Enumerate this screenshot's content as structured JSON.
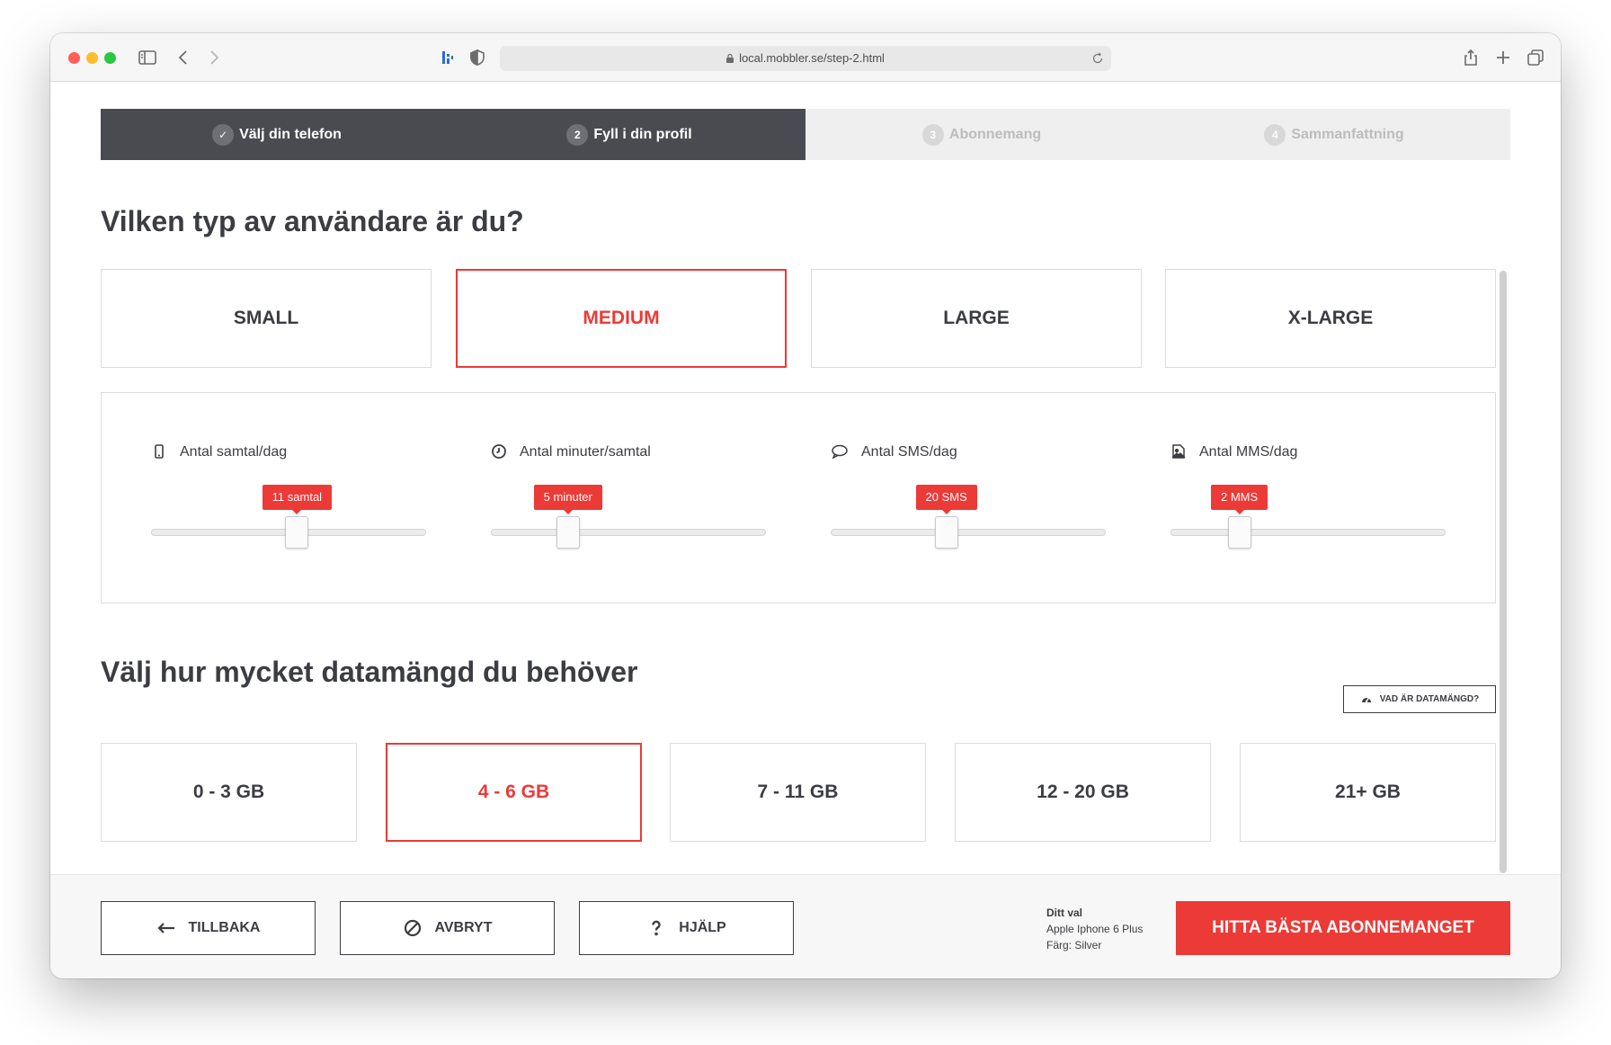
{
  "browser": {
    "url": "local.mobbler.se/step-2.html"
  },
  "stepper": {
    "steps": [
      {
        "number": "✓",
        "label": "Välj din telefon",
        "state": "done"
      },
      {
        "number": "2",
        "label": "Fyll i din profil",
        "state": "current"
      },
      {
        "number": "3",
        "label": "Abonnemang",
        "state": "future"
      },
      {
        "number": "4",
        "label": "Sammanfattning",
        "state": "future"
      }
    ]
  },
  "user_type": {
    "heading": "Vilken typ av användare är du?",
    "options": [
      "SMALL",
      "MEDIUM",
      "LARGE",
      "X-LARGE"
    ],
    "selected": "MEDIUM"
  },
  "sliders": [
    {
      "label": "Antal samtal/dag",
      "icon": "phone-icon",
      "value_label": "11 samtal",
      "fraction": 0.53
    },
    {
      "label": "Antal minuter/samtal",
      "icon": "clock-icon",
      "value_label": "5 minuter",
      "fraction": 0.28
    },
    {
      "label": "Antal SMS/dag",
      "icon": "speech-bubble-icon",
      "value_label": "20 SMS",
      "fraction": 0.42
    },
    {
      "label": "Antal MMS/dag",
      "icon": "image-icon",
      "value_label": "2 MMS",
      "fraction": 0.25
    }
  ],
  "data": {
    "heading": "Välj hur mycket datamängd du behöver",
    "info_button": "VAD ÄR DATAMÄNGD?",
    "options": [
      "0 - 3 GB",
      "4 - 6 GB",
      "7 - 11 GB",
      "12 - 20 GB",
      "21+ GB"
    ],
    "selected": "4 - 6 GB"
  },
  "footer": {
    "back": "TILLBAKA",
    "cancel": "AVBRYT",
    "help": "HJÄLP",
    "choice_title": "Ditt val",
    "choice_phone": "Apple Iphone 6 Plus",
    "choice_color": "Färg: Silver",
    "cta": "HITTA BÄSTA ABONNEMANGET"
  },
  "colors": {
    "accent": "#ec3a37",
    "stepper_active": "#4a4b50",
    "text": "#3b3d42"
  }
}
